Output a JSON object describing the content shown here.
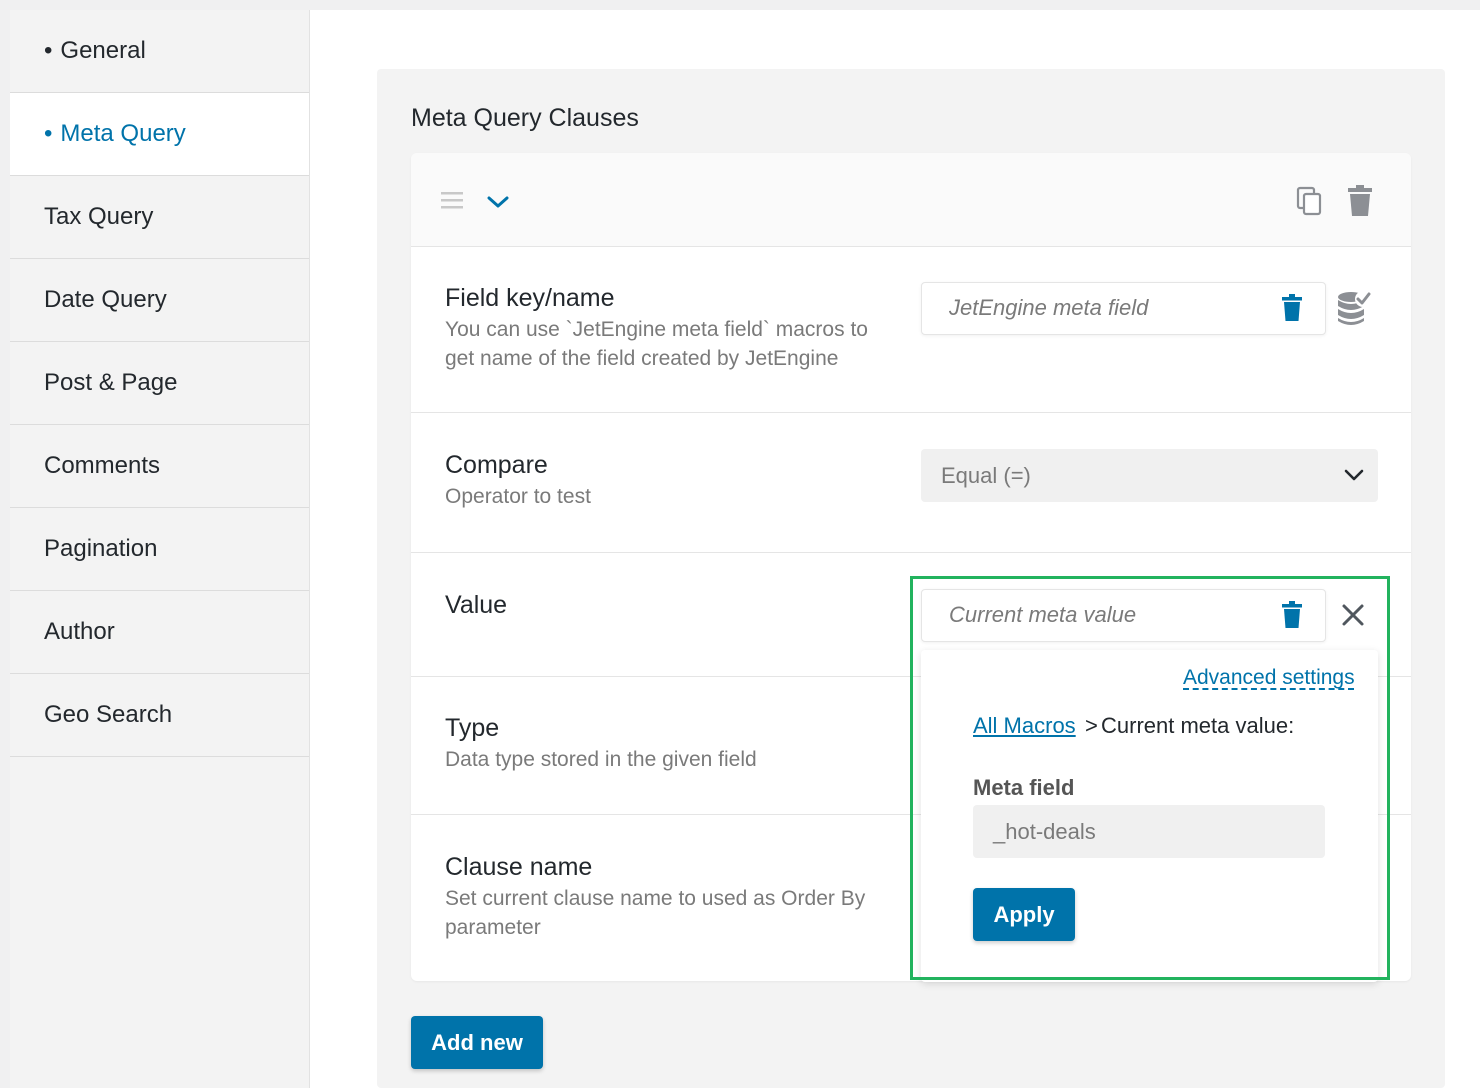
{
  "sidebar": {
    "items": [
      {
        "label": "General",
        "bullet": "•"
      },
      {
        "label": "Meta Query",
        "bullet": "•"
      },
      {
        "label": "Tax Query"
      },
      {
        "label": "Date Query"
      },
      {
        "label": "Post & Page"
      },
      {
        "label": "Comments"
      },
      {
        "label": "Pagination"
      },
      {
        "label": "Author"
      },
      {
        "label": "Geo Search"
      }
    ],
    "active_index": 1
  },
  "main": {
    "title": "Meta Query Clauses",
    "clause": {
      "field_key": {
        "label": "Field key/name",
        "description_line1": "You can use `JetEngine meta field` macros to",
        "description_line2": "get name of the field created by JetEngine",
        "value": "JetEngine meta field"
      },
      "compare": {
        "label": "Compare",
        "description": "Operator to test",
        "selected": "Equal (=)"
      },
      "value": {
        "label": "Value",
        "value": "Current meta value"
      },
      "type": {
        "label": "Type",
        "description": "Data type stored in the given field"
      },
      "clause_name": {
        "label": "Clause name",
        "description_line1": "Set current clause name to used as Order By",
        "description_line2": "parameter"
      }
    },
    "macro_popup": {
      "advanced_link": "Advanced settings",
      "breadcrumb_link": "All Macros",
      "breadcrumb_separator": ">",
      "breadcrumb_current": "Current meta value:",
      "meta_field_label": "Meta field",
      "meta_field_value": "_hot-deals",
      "apply_label": "Apply"
    },
    "add_new_label": "Add new"
  },
  "colors": {
    "accent": "#0073aa",
    "highlight_border": "#22b35e",
    "text": "#23282d",
    "muted": "#7a7a7a"
  }
}
